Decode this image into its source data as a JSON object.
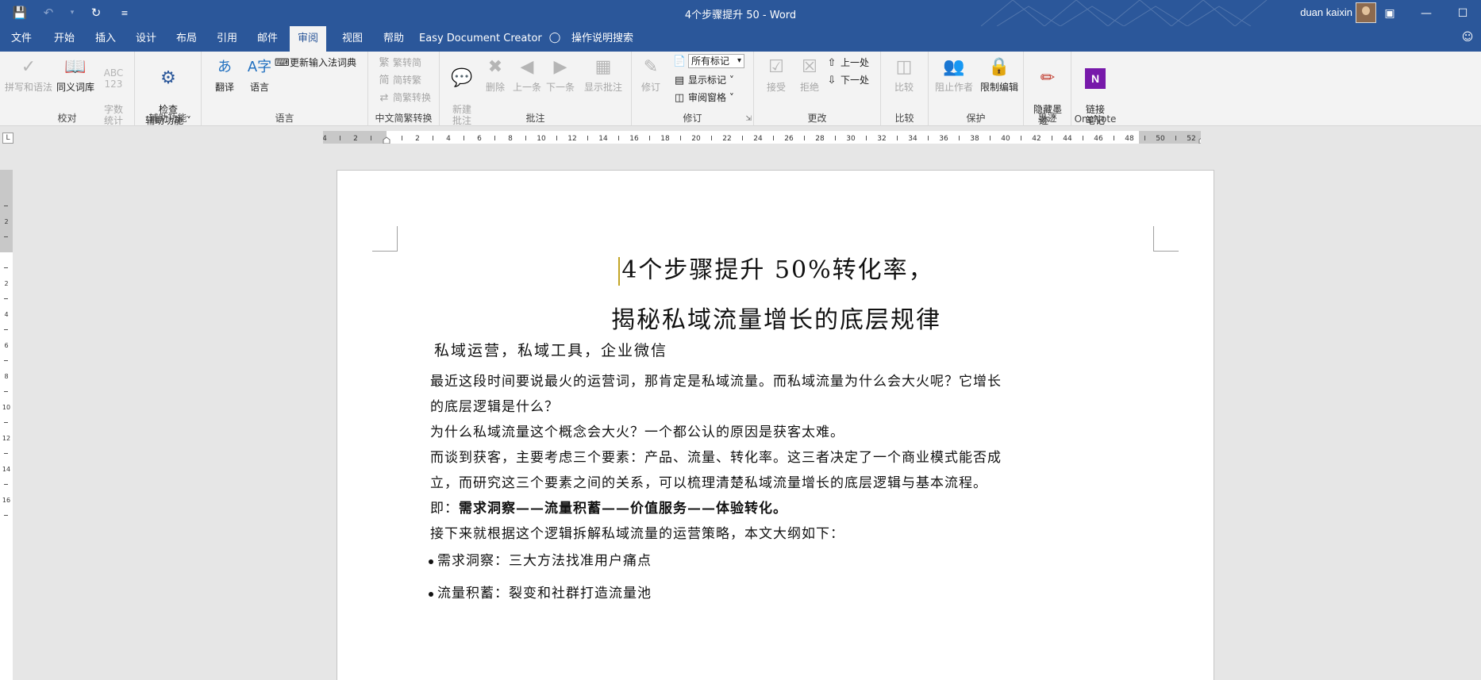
{
  "titlebar": {
    "title": "4个步骤提升 50  -  Word",
    "user": "duan kaixin"
  },
  "tabs": [
    {
      "label": "文件"
    },
    {
      "label": "开始"
    },
    {
      "label": "插入"
    },
    {
      "label": "设计"
    },
    {
      "label": "布局"
    },
    {
      "label": "引用"
    },
    {
      "label": "邮件"
    },
    {
      "label": "审阅"
    },
    {
      "label": "视图"
    },
    {
      "label": "帮助"
    },
    {
      "label": "Easy Document Creator"
    },
    {
      "label": "操作说明搜索"
    }
  ],
  "active_tab": "审阅",
  "ribbon": {
    "proofing": {
      "label": "校对",
      "spelling": "拼写和语法",
      "thesaurus": "同义词库",
      "wordcount": "字数\n统计"
    },
    "accessibility": {
      "label": "辅助功能",
      "check": "检查\n辅助功能 ˅"
    },
    "language": {
      "label": "语言",
      "translate": "翻译",
      "language": "语言",
      "update_ime": "更新输入法词典"
    },
    "chinese": {
      "label": "中文简繁转换",
      "trad_to_simp": "繁转简",
      "simp_to_trad": "简转繁",
      "convert": "简繁转换"
    },
    "comments": {
      "label": "批注",
      "new": "新建\n批注",
      "delete": "删除",
      "prev": "上一条",
      "next": "下一条",
      "show": "显示批注"
    },
    "tracking": {
      "label": "修订",
      "track": "修订",
      "markup_select": "所有标记",
      "show_markup": "显示标记 ˅",
      "review_pane": "审阅窗格 ˅"
    },
    "changes": {
      "label": "更改",
      "accept": "接受",
      "reject": "拒绝",
      "prev": "上一处",
      "next": "下一处"
    },
    "compare": {
      "label": "比较",
      "compare": "比较"
    },
    "protect": {
      "label": "保护",
      "block_authors": "阻止作者",
      "restrict": "限制编辑"
    },
    "ink": {
      "label": "墨迹",
      "hide_ink": "隐藏墨\n迹 ˅"
    },
    "onenote": {
      "label": "OneNote",
      "linked_notes": "链接\n笔记"
    }
  },
  "ruler_corner": "L",
  "document": {
    "title_line1": "4个步骤提升 50%转化率，",
    "title_line2": "揭秘私域流量增长的底层规律",
    "subtitle": "私域运营，私域工具，企业微信",
    "p1a": "最近这段时间要说最火的运营词，那肯定是私域流量。而私域流量为什么会大火呢？它增长",
    "p1b": "的底层逻辑是什么？",
    "p2": "为什么私域流量这个概念会大火？一个都公认的原因是获客太难。",
    "p3a": "而谈到获客，主要考虑三个要素：产品、流量、转化率。这三者决定了一个商业模式能否成",
    "p3b": "立，而研究这三个要素之间的关系，可以梳理清楚私域流量增长的底层逻辑与基本流程。",
    "p4_prefix": "即：",
    "p4_bold": "需求洞察——流量积蓄——价值服务——体验转化。",
    "p5": "接下来就根据这个逻辑拆解私域流量的运营策略，本文大纲如下：",
    "bullet1": "需求洞察：三大方法找准用户痛点",
    "bullet2": "流量积蓄：裂变和社群打造流量池"
  },
  "colors": {
    "accent": "#2b579a",
    "ribbon_bg": "#f3f3f3",
    "cursor": "#c2a526",
    "onenote": "#7719aa"
  }
}
